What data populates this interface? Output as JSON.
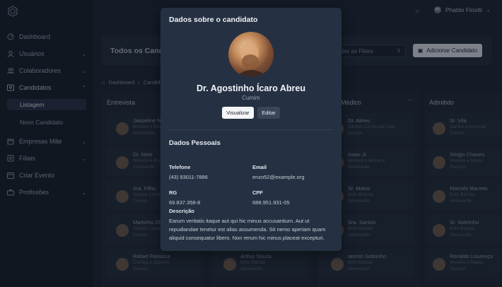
{
  "sidebar": {
    "items": [
      {
        "label": "Dashboard",
        "icon": "dashboard-icon",
        "chevron": false
      },
      {
        "label": "Usuários",
        "icon": "user-icon",
        "chevron": true
      },
      {
        "label": "Colaboradores",
        "icon": "users-icon",
        "chevron": true
      },
      {
        "label": "Candidatos",
        "icon": "id-card-icon",
        "chevron": true
      },
      {
        "label": "Empresas Mãe",
        "icon": "building-icon",
        "chevron": true
      },
      {
        "label": "Filiais",
        "icon": "branch-icon",
        "chevron": true
      },
      {
        "label": "Criar Evento",
        "icon": "calendar-icon",
        "chevron": false
      },
      {
        "label": "Profissões",
        "icon": "briefcase-icon",
        "chevron": true
      }
    ],
    "sub_items": [
      "Listagem",
      "Novo Candidato"
    ]
  },
  "topbar": {
    "user_name": "Phablo Finotti",
    "user_initials": "PF"
  },
  "page": {
    "title": "Todos os Candidatos",
    "filter_placeholder": "Todas as Filiais",
    "add_button": "Adicionar Candidato",
    "breadcrumb": [
      "Dashboard",
      "Candidatos"
    ]
  },
  "columns": [
    {
      "title": "Entrevista"
    },
    {
      "title": ""
    },
    {
      "title": "Médico"
    },
    {
      "title": "Admitido"
    }
  ],
  "cards": {
    "col1": [
      {
        "name": "Jaqueline Neto",
        "company": "Moreira e Braga",
        "role": "Almoxarife"
      },
      {
        "name": "Dr. Neto",
        "company": "Moreira e Braga",
        "role": "Almoxarife"
      },
      {
        "name": "Sra. Filho",
        "company": "Santos Comercial",
        "role": "Cumim"
      },
      {
        "name": "Martinho Oliveira",
        "company": "Santos Comercial",
        "role": "Cumim"
      },
      {
        "name": "Rafael Fonseca",
        "company": "Correia e Jacome",
        "role": "Cumim"
      }
    ],
    "col2": [
      {
        "name": "Arthur Souza",
        "company": "Brito Batista",
        "role": "Almoxarife"
      }
    ],
    "col3": [
      {
        "name": "Dr. Abreu",
        "company": "Santos Comercial Ltda.",
        "role": "Cumim"
      },
      {
        "name": "Isaac Jr.",
        "company": "Moreira e Bezerra",
        "role": "Almoxarife"
      },
      {
        "name": "Sr. Matos",
        "company": "Brito Batista",
        "role": "Almoxarife"
      },
      {
        "name": "Sra. Santos",
        "company": "Brito Batista",
        "role": "Almoxarife"
      },
      {
        "name": "Iasmin Sobrinho",
        "company": "Brito Batista",
        "role": "Almoxarife"
      }
    ],
    "col4": [
      {
        "name": "Sr. Vila",
        "company": "Santos Comercial",
        "role": "Cumim"
      },
      {
        "name": "Sérgio Chaves",
        "company": "Moreira e Matos",
        "role": "Garçom"
      },
      {
        "name": "Marcelo Barreto",
        "company": "Brito Batista",
        "role": "Almoxarife"
      },
      {
        "name": "Sr. Sobrinho",
        "company": "Brito Batista",
        "role": "Almoxarife"
      },
      {
        "name": "Ronaldo Lourenço",
        "company": "Moreira e Matos",
        "role": "Garçom"
      }
    ]
  },
  "modal": {
    "title": "Dados sobre o candidato",
    "name": "Dr. Agostinho Ícaro Abreu",
    "role": "Cumim",
    "view_button": "Visualizar",
    "edit_button": "Editar",
    "section_title": "Dados Pessoais",
    "phone_label": "Telefone",
    "phone_value": "(43) 93011-7886",
    "email_label": "Email",
    "email_value": "enzo52@example.org",
    "rg_label": "RG",
    "rg_value": "69.837.358-8",
    "cpf_label": "CPF",
    "cpf_value": "688.951.931-05",
    "description_label": "Descrição",
    "description_value": "Earum veritatis itaque aut qui hic minus accusantium. Aut ut repudiandae tenetur est alias assumenda. Sit nemo aperiam quam aliquid consequatur libero. Non rerum hic minus placeat excepturi."
  }
}
